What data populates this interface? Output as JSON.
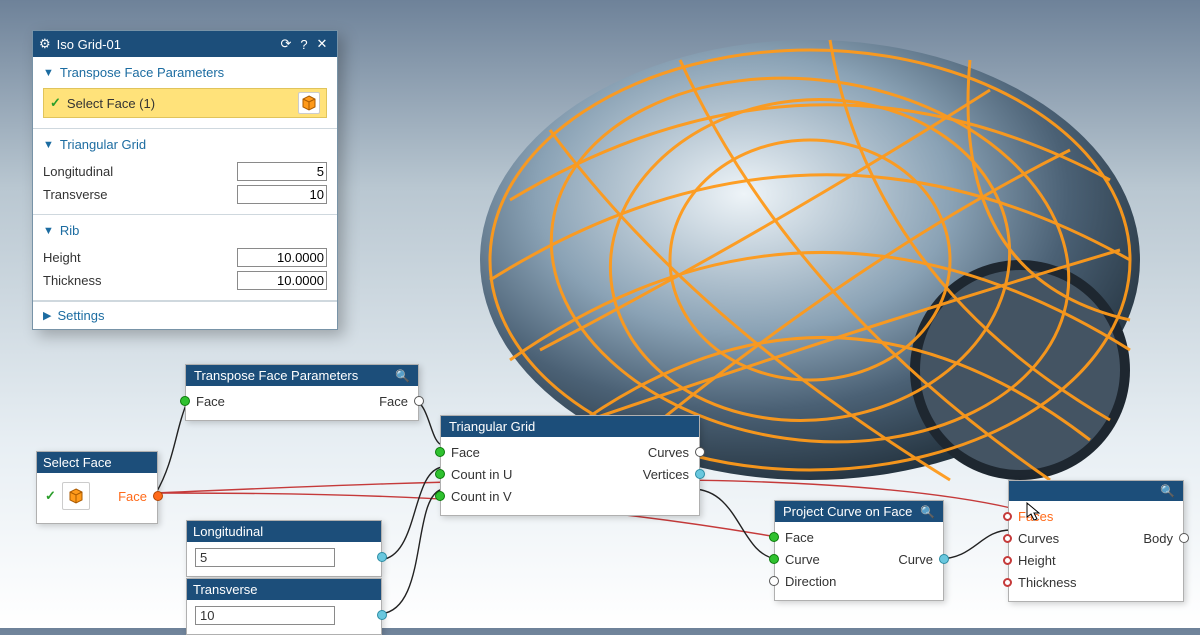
{
  "panel": {
    "title": "Iso Grid-01",
    "transpose_section": "Transpose Face Parameters",
    "select_face_label": "Select Face (1)",
    "tri_section": "Triangular Grid",
    "longitudinal_label": "Longitudinal",
    "longitudinal_value": "5",
    "transverse_label": "Transverse",
    "transverse_value": "10",
    "rib_section": "Rib",
    "height_label": "Height",
    "height_value": "10.0000",
    "thickness_label": "Thickness",
    "thickness_value": "10.0000",
    "settings_label": "Settings"
  },
  "nodes": {
    "select_face": {
      "title": "Select Face",
      "face_label": "Face"
    },
    "transpose": {
      "title": "Transpose Face Parameters",
      "in_face": "Face",
      "out_face": "Face"
    },
    "trigrid": {
      "title": "Triangular Grid",
      "face": "Face",
      "count_u": "Count in U",
      "count_v": "Count in V",
      "curves": "Curves",
      "vertices": "Vertices"
    },
    "longitudinal": {
      "title": "Longitudinal",
      "value": "5"
    },
    "transverse": {
      "title": "Transverse",
      "value": "10"
    },
    "project": {
      "title": "Project Curve on Face",
      "face": "Face",
      "curve": "Curve",
      "direction": "Direction",
      "out_curve": "Curve"
    },
    "rib": {
      "faces": "Faces",
      "curves": "Curves",
      "height": "Height",
      "thickness": "Thickness",
      "body": "Body"
    }
  }
}
